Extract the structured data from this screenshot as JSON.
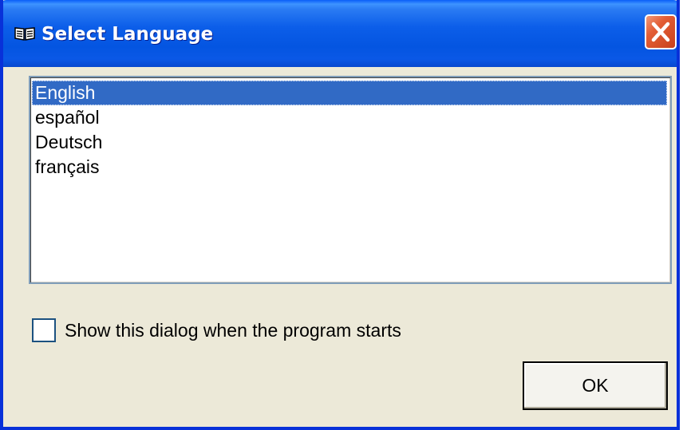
{
  "window": {
    "title": "Select Language",
    "icon": "book-icon",
    "close_icon": "close-icon"
  },
  "language_list": {
    "selected_index": 0,
    "items": [
      {
        "label": "English"
      },
      {
        "label": "español"
      },
      {
        "label": "Deutsch"
      },
      {
        "label": "français"
      }
    ]
  },
  "startup_option": {
    "label": "Show this dialog when the program starts",
    "checked": false
  },
  "buttons": {
    "ok_label": "OK"
  },
  "colors": {
    "titlebar": "#0a58e6",
    "selection": "#316ac5",
    "close_button": "#e35e36",
    "dialog_background": "#ece9d8"
  }
}
